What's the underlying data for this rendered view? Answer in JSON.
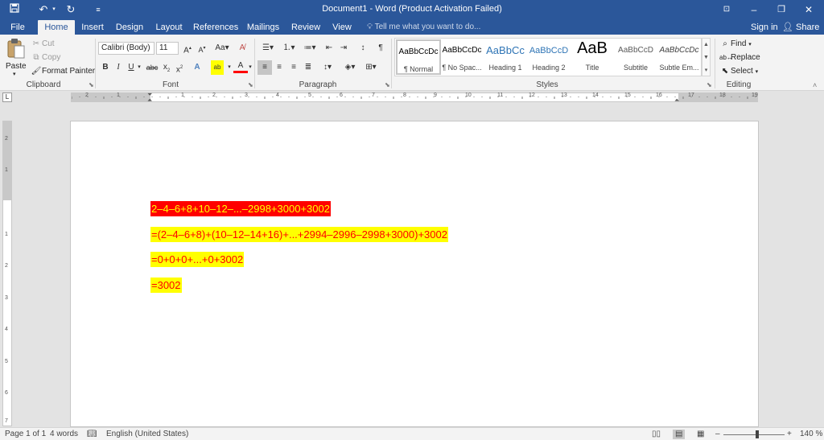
{
  "window": {
    "title": "Document1 - Word (Product Activation Failed)",
    "accent": "#2b579a"
  },
  "quick_access": {
    "save_icon": "save-icon",
    "undo_icon": "undo-icon",
    "redo_icon": "redo-icon",
    "customize_icon": "customize-toolbar-icon"
  },
  "tabs": [
    {
      "label": "File"
    },
    {
      "label": "Home"
    },
    {
      "label": "Insert"
    },
    {
      "label": "Design"
    },
    {
      "label": "Layout"
    },
    {
      "label": "References"
    },
    {
      "label": "Mailings"
    },
    {
      "label": "Review"
    },
    {
      "label": "View"
    }
  ],
  "active_tab": "Home",
  "tell_me": "Tell me what you want to do...",
  "account": {
    "sign_in": "Sign in",
    "share": "Share"
  },
  "ribbon": {
    "clipboard": {
      "label": "Clipboard",
      "paste": "Paste",
      "cut": "Cut",
      "copy": "Copy",
      "format_painter": "Format Painter"
    },
    "font": {
      "label": "Font",
      "font_name": "Calibri (Body)",
      "font_size": "11"
    },
    "paragraph": {
      "label": "Paragraph"
    },
    "styles": {
      "label": "Styles",
      "items": [
        {
          "preview": "AaBbCcDc",
          "name": "¶ Normal"
        },
        {
          "preview": "AaBbCcDc",
          "name": "¶ No Spac..."
        },
        {
          "preview": "AaBbCc",
          "name": "Heading 1"
        },
        {
          "preview": "AaBbCcD",
          "name": "Heading 2"
        },
        {
          "preview": "AaB",
          "name": "Title"
        },
        {
          "preview": "AaBbCcD",
          "name": "Subtitle"
        },
        {
          "preview": "AaBbCcDc",
          "name": "Subtle Em..."
        }
      ]
    },
    "editing": {
      "label": "Editing",
      "find": "Find",
      "replace": "Replace",
      "select": "Select"
    }
  },
  "ruler": {
    "h_numbers": [
      "2",
      "1",
      "1",
      "2",
      "3",
      "4",
      "5",
      "6",
      "7",
      "8",
      "9",
      "10",
      "11",
      "12",
      "13",
      "14",
      "15",
      "16",
      "17",
      "18",
      "19"
    ],
    "v_numbers": [
      "2",
      "1",
      "1",
      "2",
      "3",
      "4",
      "5",
      "6",
      "7"
    ]
  },
  "document": {
    "lines": [
      {
        "text": "2–4–6+8+10–12–...–2998+3000+3002",
        "highlight": "red"
      },
      {
        "text": "=(2–4–6+8)+(10–12–14+16)+...+2994–2996–2998+3000)+3002",
        "highlight": "yellow"
      },
      {
        "text": "=0+0+0+...+0+3002",
        "highlight": "yellow"
      },
      {
        "text": "=3002",
        "highlight": "yellow"
      }
    ]
  },
  "status": {
    "page": "Page 1 of 1",
    "words": "4 words",
    "language": "English (United States)",
    "zoom_minus": "–",
    "zoom_plus": "+",
    "zoom": "140 %",
    "zoom_percent": 140
  }
}
